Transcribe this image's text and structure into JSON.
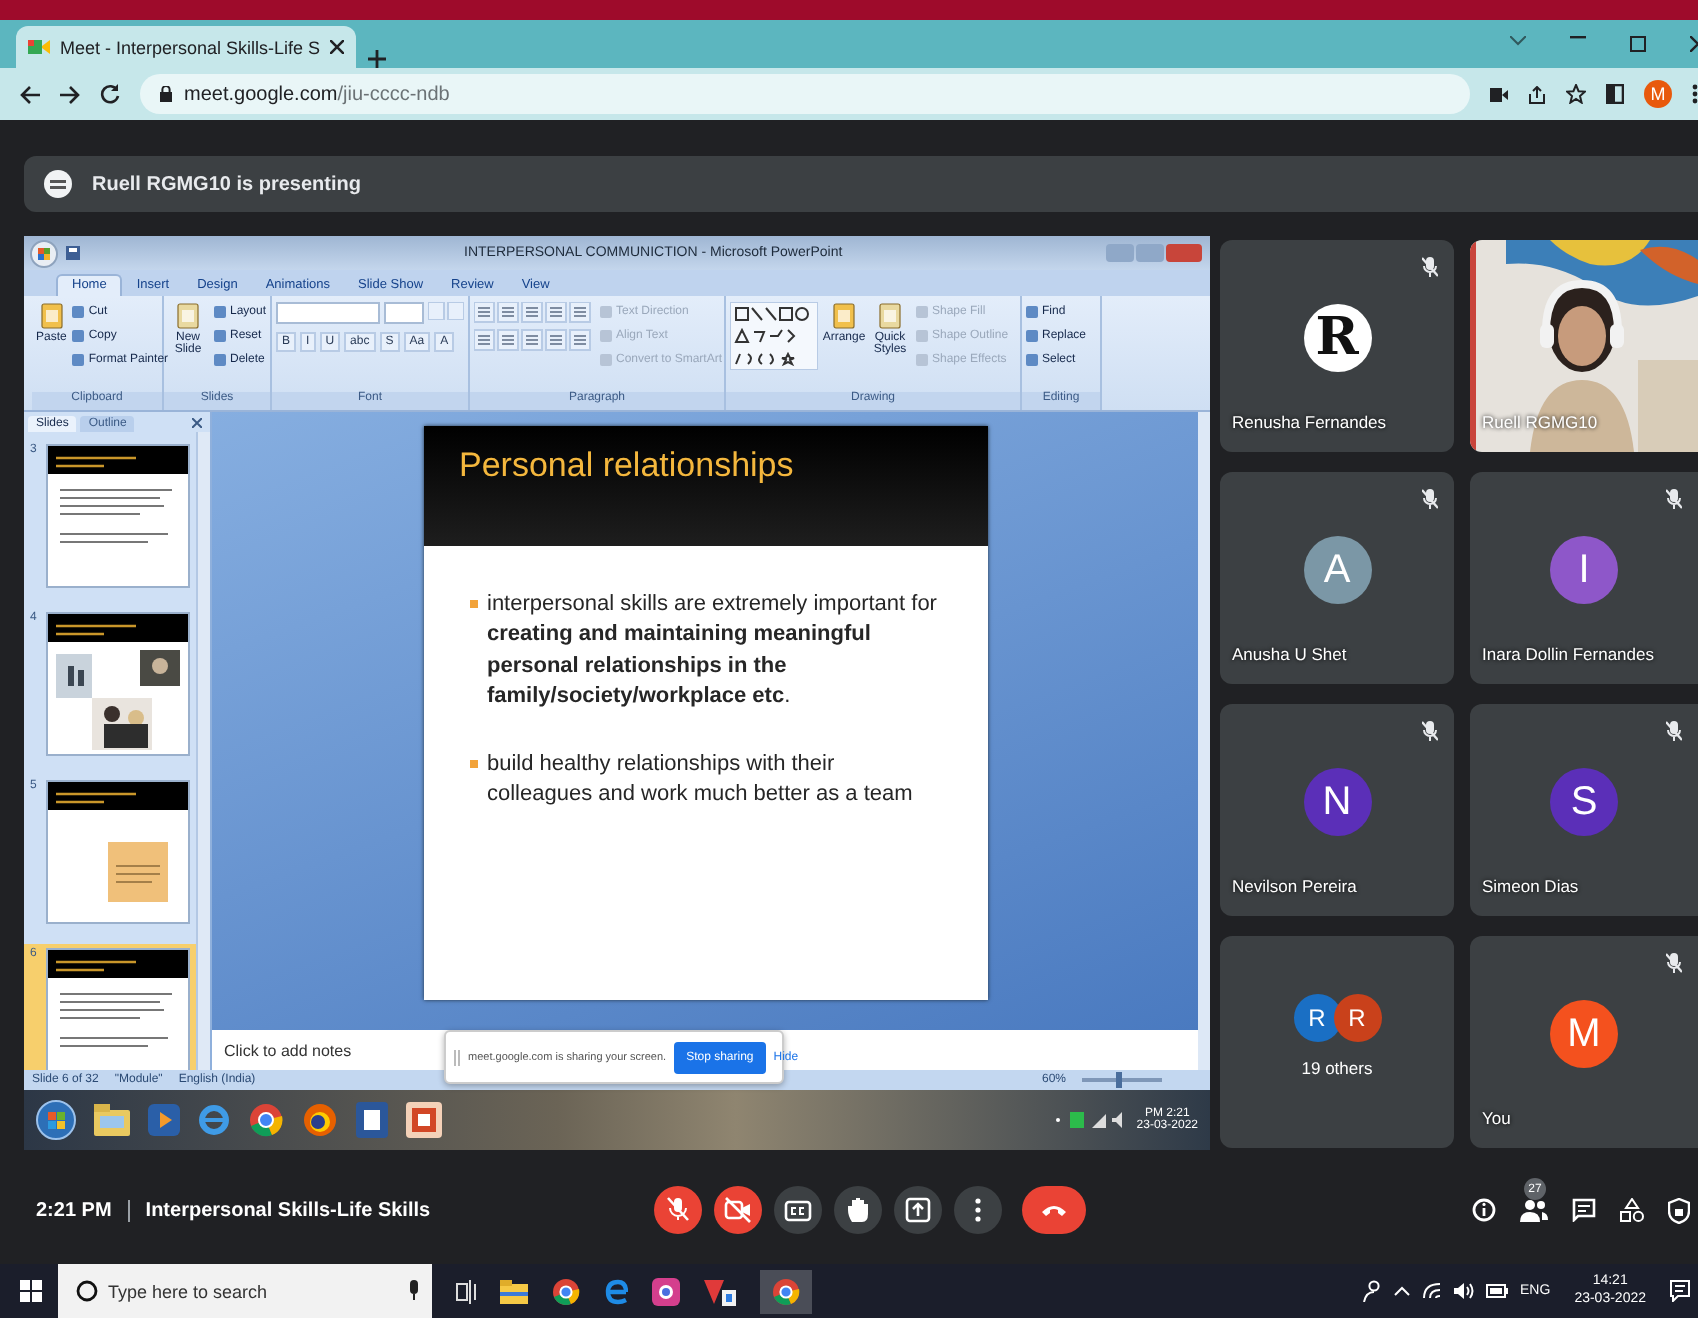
{
  "browser": {
    "tab_title": "Meet - Interpersonal Skills-Life S",
    "url_host": "meet.google.com",
    "url_path": "/jiu-cccc-ndb",
    "profile_initial": "M"
  },
  "banner": {
    "text": "Ruell RGMG10 is presenting"
  },
  "presentation": {
    "title": "INTERPERSONAL COMMUNICTION - Microsoft PowerPoint",
    "ribbon_tabs": [
      {
        "label": "Home",
        "selected": true
      },
      {
        "label": "Insert",
        "selected": false
      },
      {
        "label": "Design",
        "selected": false
      },
      {
        "label": "Animations",
        "selected": false
      },
      {
        "label": "Slide Show",
        "selected": false
      },
      {
        "label": "Review",
        "selected": false
      },
      {
        "label": "View",
        "selected": false
      }
    ],
    "ribbon_groups": [
      {
        "kind": "clipboard",
        "label": "Clipboard",
        "large": [
          "Paste"
        ],
        "small": [
          {
            "label": "Cut",
            "disabled": false
          },
          {
            "label": "Copy",
            "disabled": false
          },
          {
            "label": "Format Painter",
            "disabled": false
          }
        ]
      },
      {
        "kind": "slides",
        "label": "Slides",
        "large": [
          "New Slide"
        ],
        "small": [
          {
            "label": "Layout",
            "disabled": false
          },
          {
            "label": "Reset",
            "disabled": false
          },
          {
            "label": "Delete",
            "disabled": false
          }
        ]
      },
      {
        "kind": "font",
        "label": "Font",
        "buttons": [
          "B",
          "I",
          "U",
          "abc",
          "S",
          "Aa",
          "A"
        ]
      },
      {
        "kind": "paragraph",
        "label": "Paragraph",
        "small": [
          {
            "label": "Text Direction",
            "disabled": true
          },
          {
            "label": "Align Text",
            "disabled": true
          },
          {
            "label": "Convert to SmartArt",
            "disabled": true
          }
        ]
      },
      {
        "kind": "drawing",
        "label": "Drawing",
        "large": [
          "Arrange",
          "Quick Styles"
        ],
        "small": [
          {
            "label": "Shape Fill",
            "disabled": true
          },
          {
            "label": "Shape Outline",
            "disabled": true
          },
          {
            "label": "Shape Effects",
            "disabled": true
          }
        ]
      },
      {
        "kind": "editing",
        "label": "Editing",
        "small": [
          {
            "label": "Find",
            "disabled": false
          },
          {
            "label": "Replace",
            "disabled": false
          },
          {
            "label": "Select",
            "disabled": false
          }
        ]
      }
    ],
    "pane_tabs": [
      {
        "label": "Slides",
        "selected": true
      },
      {
        "label": "Outline",
        "selected": false
      }
    ],
    "thumbnails": [
      {
        "number": "3",
        "kind": "text",
        "selected": false
      },
      {
        "number": "4",
        "kind": "photos",
        "selected": false
      },
      {
        "number": "5",
        "kind": "note",
        "selected": false
      },
      {
        "number": "6",
        "kind": "text",
        "selected": true
      }
    ],
    "slide": {
      "title": "Personal relationships",
      "bullets": [
        "interpersonal skills are extremely important for **creating and maintaining meaningful personal relationships in the family/society/workplace etc**.",
        "build healthy relationships with their colleagues and work much better as a team"
      ]
    },
    "notes_placeholder": "Click to add notes",
    "status": [
      "Slide 6 of 32",
      "\"Module\"",
      "English (India)"
    ],
    "zoom": {
      "reading": "60%",
      "level": 0.45
    },
    "share_prompt": {
      "message": "meet.google.com is sharing your screen.",
      "stop": "Stop sharing",
      "hide": "Hide"
    },
    "taskbar": {
      "time": "PM 2:21",
      "date": "23-03-2022"
    }
  },
  "participants": [
    {
      "kind": "logo",
      "name": "Renusha Fernandes",
      "initial": "R",
      "muted": true
    },
    {
      "kind": "video",
      "name": "Ruell RGMG10",
      "muted": false
    },
    {
      "kind": "avatar",
      "name": "Anusha U Shet",
      "initial": "A",
      "color": "#7b97a6",
      "muted": true
    },
    {
      "kind": "avatar",
      "name": "Inara Dollin Fernandes",
      "initial": "I",
      "color": "#8e57c9",
      "muted": true
    },
    {
      "kind": "avatar",
      "name": "Nevilson Pereira",
      "initial": "N",
      "color": "#5b2fb8",
      "muted": true
    },
    {
      "kind": "avatar",
      "name": "Simeon Dias",
      "initial": "S",
      "color": "#5b2fb8",
      "muted": true
    },
    {
      "kind": "group",
      "label": "19 others",
      "avatars": [
        {
          "initial": "R",
          "color": "#1a6fc4"
        },
        {
          "initial": "R",
          "color": "#c9411b"
        }
      ],
      "muted": false
    },
    {
      "kind": "avatar",
      "name": "You",
      "initial": "M",
      "color": "#f4511e",
      "muted": true
    }
  ],
  "meeting_bar": {
    "time": "2:21 PM",
    "title": "Interpersonal Skills-Life Skills",
    "participant_count": "27",
    "controls": [
      {
        "kind": "mic",
        "on": false
      },
      {
        "kind": "camera",
        "on": false
      },
      {
        "kind": "captions",
        "on": false
      },
      {
        "kind": "hand",
        "on": false
      },
      {
        "kind": "present",
        "on": false
      },
      {
        "kind": "more"
      },
      {
        "kind": "leave"
      }
    ]
  },
  "taskbar": {
    "search_placeholder": "Type here to search",
    "language": "ENG",
    "time": "14:21",
    "date": "23-03-2022"
  }
}
